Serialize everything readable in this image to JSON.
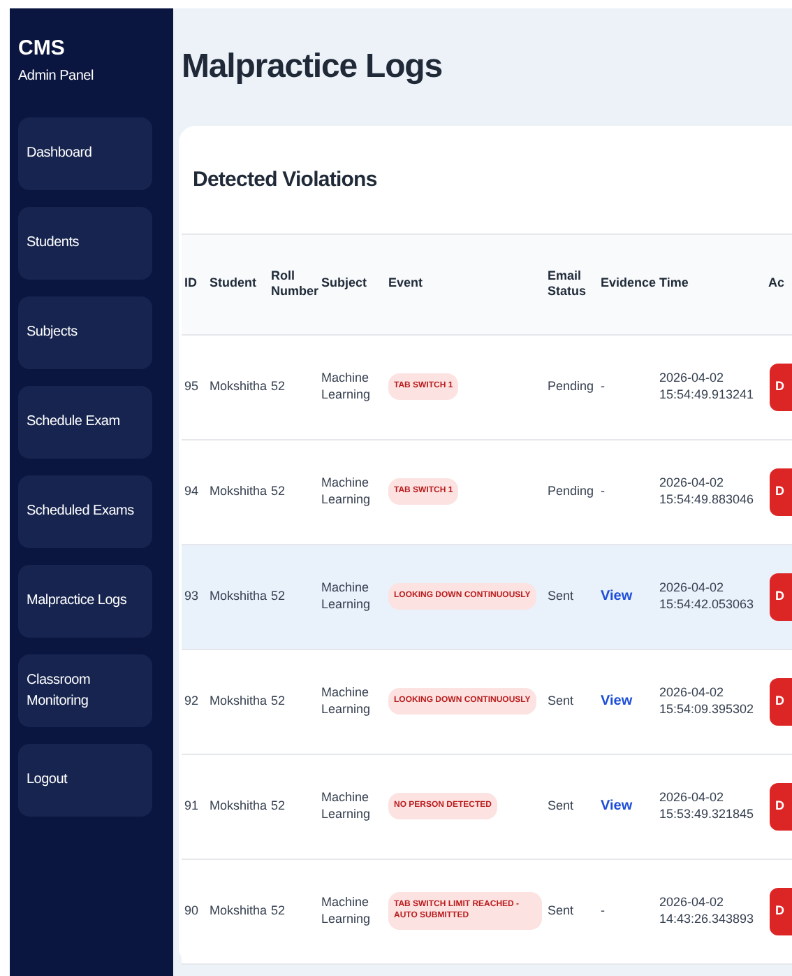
{
  "brand": {
    "title": "CMS",
    "subtitle": "Admin Panel"
  },
  "sidebar": {
    "items": [
      {
        "label": "Dashboard",
        "selected": false
      },
      {
        "label": "Students",
        "selected": false
      },
      {
        "label": "Subjects",
        "selected": false
      },
      {
        "label": "Schedule Exam",
        "selected": false
      },
      {
        "label": "Scheduled Exams",
        "selected": false
      },
      {
        "label": "Malpractice Logs",
        "selected": false
      },
      {
        "label": "Classroom Monitoring",
        "selected": false
      },
      {
        "label": "Logout",
        "selected": false
      }
    ]
  },
  "page_title": "Malpractice Logs",
  "card": {
    "title": "Detected Violations",
    "table": {
      "columns": [
        "ID",
        "Student",
        "Roll Number",
        "Subject",
        "Event",
        "Email Status",
        "Evidence",
        "Time",
        "Ac"
      ],
      "rows": [
        {
          "id": "95",
          "student": "Mokshitha",
          "roll": "52",
          "subject": "Machine Learning",
          "event": "TAB SWITCH 1",
          "email_status": "Pending",
          "evidence": {
            "text": "-",
            "kind": "plain"
          },
          "time": "2026-04-02 15:54:49.913241",
          "action": "D",
          "selected": false
        },
        {
          "id": "94",
          "student": "Mokshitha",
          "roll": "52",
          "subject": "Machine Learning",
          "event": "TAB SWITCH 1",
          "email_status": "Pending",
          "evidence": {
            "text": "-",
            "kind": "plain"
          },
          "time": "2026-04-02 15:54:49.883046",
          "action": "D",
          "selected": false
        },
        {
          "id": "93",
          "student": "Mokshitha",
          "roll": "52",
          "subject": "Machine Learning",
          "event": "LOOKING DOWN CONTINUOUSLY",
          "email_status": "Sent",
          "evidence": {
            "text": "View",
            "kind": "link"
          },
          "time": "2026-04-02 15:54:42.053063",
          "action": "D",
          "selected": true
        },
        {
          "id": "92",
          "student": "Mokshitha",
          "roll": "52",
          "subject": "Machine Learning",
          "event": "LOOKING DOWN CONTINUOUSLY",
          "email_status": "Sent",
          "evidence": {
            "text": "View",
            "kind": "link"
          },
          "time": "2026-04-02 15:54:09.395302",
          "action": "D",
          "selected": false
        },
        {
          "id": "91",
          "student": "Mokshitha",
          "roll": "52",
          "subject": "Machine Learning",
          "event": "NO PERSON DETECTED",
          "email_status": "Sent",
          "evidence": {
            "text": "View",
            "kind": "link"
          },
          "time": "2026-04-02 15:53:49.321845",
          "action": "D",
          "selected": false
        },
        {
          "id": "90",
          "student": "Mokshitha",
          "roll": "52",
          "subject": "Machine Learning",
          "event": "TAB SWITCH LIMIT REACHED - AUTO SUBMITTED",
          "email_status": "Sent",
          "evidence": {
            "text": "-",
            "kind": "plain"
          },
          "time": "2026-04-02 14:43:26.343893",
          "action": "D",
          "selected": false
        }
      ]
    }
  }
}
